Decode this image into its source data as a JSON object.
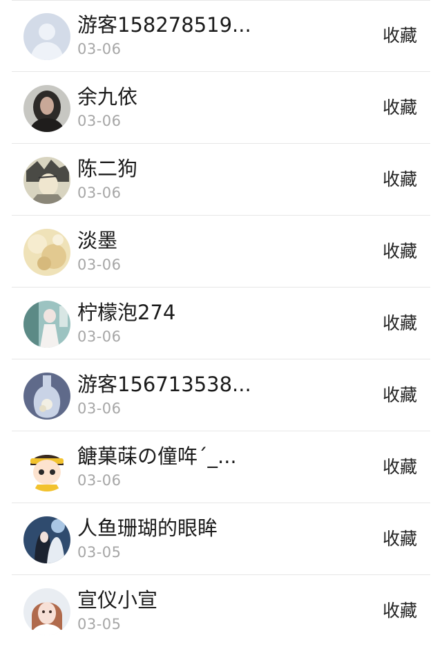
{
  "items": [
    {
      "name": "游客158278519...",
      "date": "03-06",
      "action": "收藏",
      "avatar": "default-avatar-icon"
    },
    {
      "name": "余九依",
      "date": "03-06",
      "action": "收藏",
      "avatar": "user-photo"
    },
    {
      "name": "陈二狗",
      "date": "03-06",
      "action": "收藏",
      "avatar": "user-photo"
    },
    {
      "name": "淡墨",
      "date": "03-06",
      "action": "收藏",
      "avatar": "user-photo"
    },
    {
      "name": "柠檬泡274",
      "date": "03-06",
      "action": "收藏",
      "avatar": "user-photo"
    },
    {
      "name": "游客156713538...",
      "date": "03-06",
      "action": "收藏",
      "avatar": "user-photo"
    },
    {
      "name": "餹菓菋の僮哖ˊ_...",
      "date": "03-06",
      "action": "收藏",
      "avatar": "cartoon-avatar"
    },
    {
      "name": "人鱼珊瑚的眼眸",
      "date": "03-05",
      "action": "收藏",
      "avatar": "user-photo"
    },
    {
      "name": "宣仪小宣",
      "date": "03-05",
      "action": "收藏",
      "avatar": "user-photo"
    }
  ]
}
